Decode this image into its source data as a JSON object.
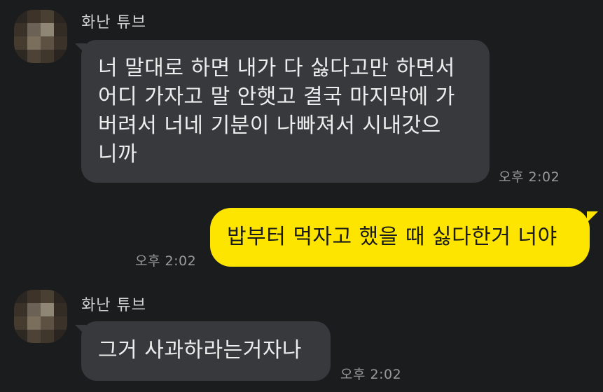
{
  "messages": [
    {
      "sender": "화난 튜브",
      "lines": [
        "너 말대로 하면 내가 다 싫다고만 하면서",
        "어디 가자고 말 안햇고 결국 마지막에 가",
        "버려서 너네 기분이 나빠져서 시내갓으",
        "니까"
      ],
      "time": "오후 2:02",
      "direction": "incoming"
    },
    {
      "sender": "",
      "lines": [
        "밥부터 먹자고 했을 때 싫다한거 너야"
      ],
      "time": "오후 2:02",
      "direction": "outgoing"
    },
    {
      "sender": "화난 튜브",
      "lines": [
        "그거 사과하라는거자나"
      ],
      "time": "오후 2:02",
      "direction": "incoming"
    }
  ],
  "colors": {
    "background": "#1b1c1e",
    "incoming_bubble": "#38393c",
    "outgoing_bubble": "#fee500"
  }
}
